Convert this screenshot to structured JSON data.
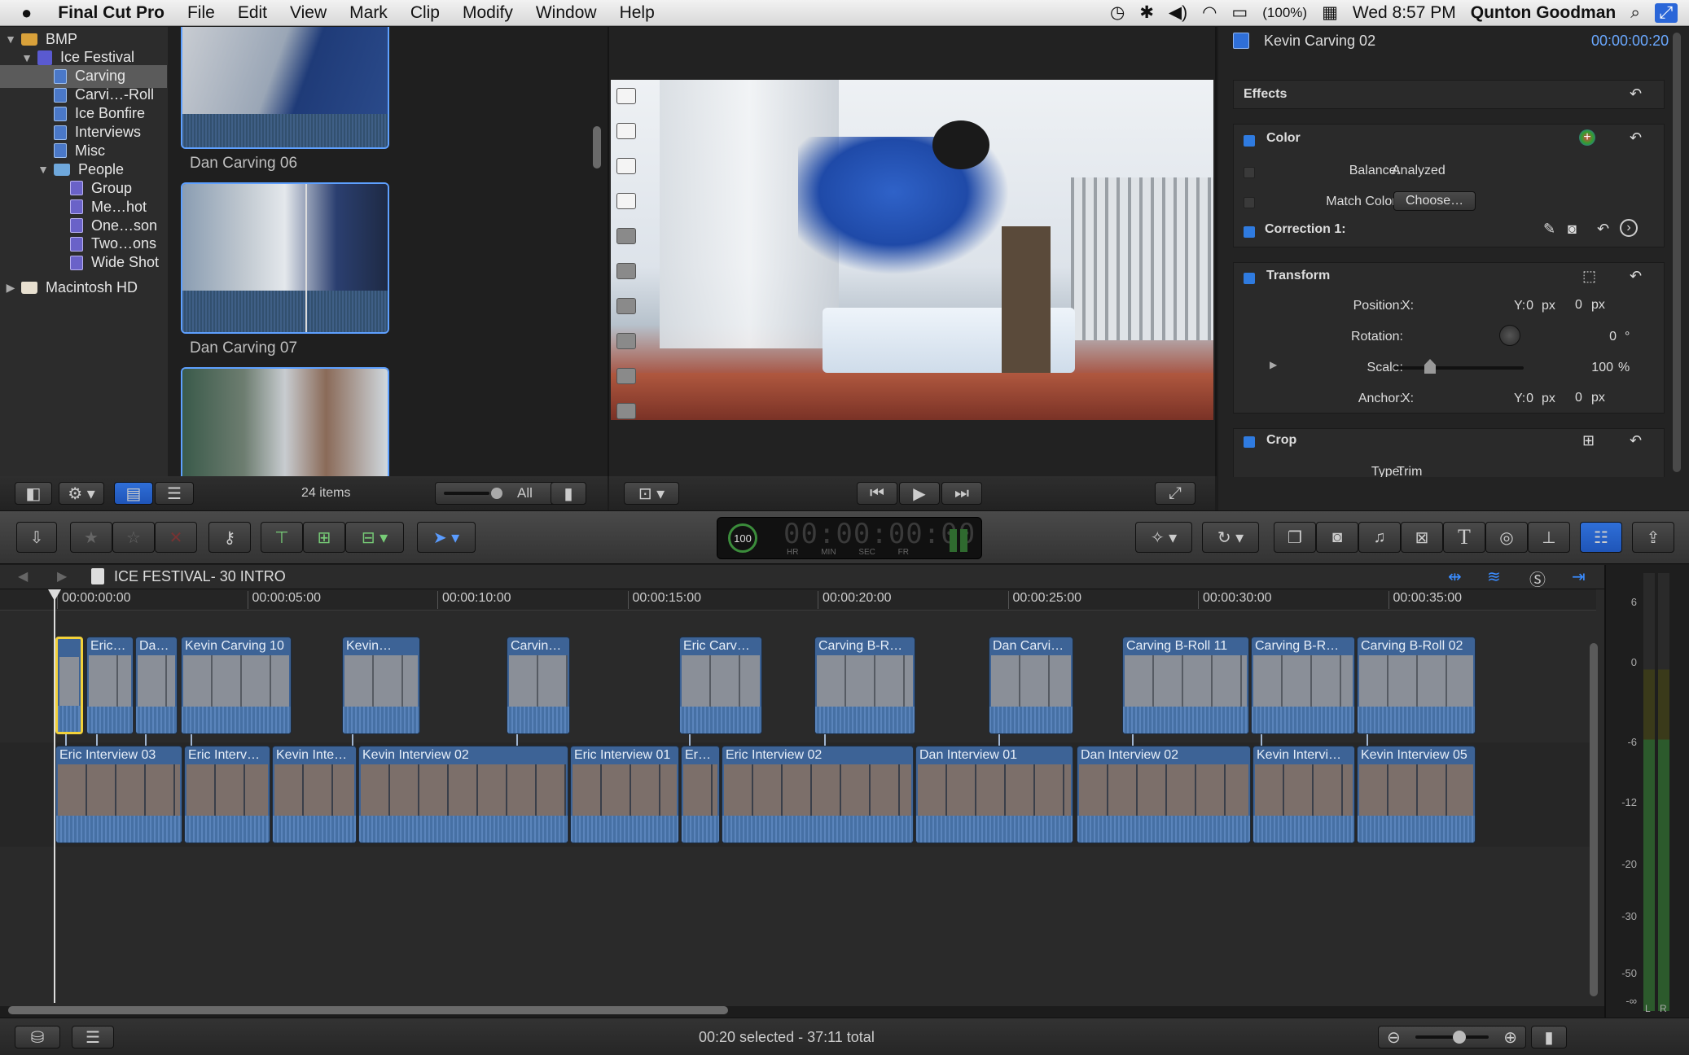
{
  "menubar": {
    "app": "Final Cut Pro",
    "items": [
      "File",
      "Edit",
      "View",
      "Mark",
      "Clip",
      "Modify",
      "Window",
      "Help"
    ],
    "battery": "(100%)",
    "clock": "Wed 8:57 PM",
    "user": "Qunton Goodman"
  },
  "library": {
    "items": [
      {
        "label": "BMP",
        "indent": 0,
        "icon": "library-icon",
        "disclosure": "▼"
      },
      {
        "label": "Ice Festival",
        "indent": 1,
        "icon": "event-star-icon",
        "disclosure": "▼"
      },
      {
        "label": "Carving",
        "indent": 2,
        "icon": "keyword-collection-icon",
        "selected": true
      },
      {
        "label": "Carvi…-Roll",
        "indent": 2,
        "icon": "keyword-collection-icon"
      },
      {
        "label": "Ice Bonfire",
        "indent": 2,
        "icon": "keyword-collection-icon"
      },
      {
        "label": "Interviews",
        "indent": 2,
        "icon": "keyword-collection-icon"
      },
      {
        "label": "Misc",
        "indent": 2,
        "icon": "keyword-collection-icon"
      },
      {
        "label": "People",
        "indent": 2,
        "icon": "folder-icon",
        "disclosure": "▼"
      },
      {
        "label": "Group",
        "indent": 3,
        "icon": "smart-collection-icon"
      },
      {
        "label": "Me…hot",
        "indent": 3,
        "icon": "smart-collection-icon"
      },
      {
        "label": "One…son",
        "indent": 3,
        "icon": "smart-collection-icon"
      },
      {
        "label": "Two…ons",
        "indent": 3,
        "icon": "smart-collection-icon"
      },
      {
        "label": "Wide Shot",
        "indent": 3,
        "icon": "smart-collection-icon"
      },
      {
        "label": "Macintosh HD",
        "indent": 0,
        "icon": "home-icon",
        "disclosure": "▶"
      }
    ]
  },
  "browser": {
    "clips": [
      "Dan Carving 06",
      "Dan Carving 07"
    ],
    "count": "24 items",
    "filter": "All"
  },
  "inspector": {
    "clip_name": "Kevin Carving 02",
    "timecode": "00:00:00:20",
    "effects": "Effects",
    "color": "Color",
    "balance_label": "Balance:",
    "balance_value": "Analyzed",
    "match_label": "Match Color:",
    "match_button": "Choose…",
    "correction": "Correction 1:",
    "transform": "Transform",
    "position_label": "Position:",
    "x_label": "X:",
    "y_label": "Y:",
    "position_x": "0",
    "position_y": "0",
    "px": "px",
    "rotation_label": "Rotation:",
    "rotation_value": "0",
    "degree": "°",
    "scale_label": "Scale:",
    "scale_value": "100",
    "percent": "%",
    "anchor_label": "Anchor:",
    "anchor_x": "0",
    "anchor_y": "0",
    "crop": "Crop",
    "type_label": "Type:",
    "type_value": "Trim"
  },
  "dashboard": {
    "percent": "100",
    "timecode": "00:00:00:00",
    "units": [
      "HR",
      "MIN",
      "SEC",
      "FR"
    ]
  },
  "timeline": {
    "project": "ICE FESTIVAL- 30 INTRO",
    "ruler": [
      "00:00:00:00",
      "00:00:05:00",
      "00:00:10:00",
      "00:00:15:00",
      "00:00:20:00",
      "00:00:25:00",
      "00:00:30:00",
      "00:00:35:00"
    ],
    "connected": [
      "",
      "Eric…",
      "Da…",
      "Kevin Carving 10",
      "Kevin…",
      "Carvin…",
      "Eric Carv…",
      "Carving B-R…",
      "Dan Carvi…",
      "Carving B-Roll 11",
      "Carving B-R…",
      "Carving B-Roll 02"
    ],
    "primary": [
      "Eric Interview 03",
      "Eric Interv…",
      "Kevin Inte…",
      "Kevin Interview 02",
      "Eric Interview 01",
      "Er…",
      "Eric Interview 02",
      "Dan Interview 01",
      "Dan Interview 02",
      "Kevin Intervi…",
      "Kevin Interview 05"
    ],
    "status": "00:20 selected - 37:11 total"
  },
  "meters": {
    "labels": [
      "6",
      "0",
      "-6",
      "-12",
      "-20",
      "-30",
      "-50",
      "-∞"
    ],
    "channels": [
      "L",
      "R"
    ]
  }
}
